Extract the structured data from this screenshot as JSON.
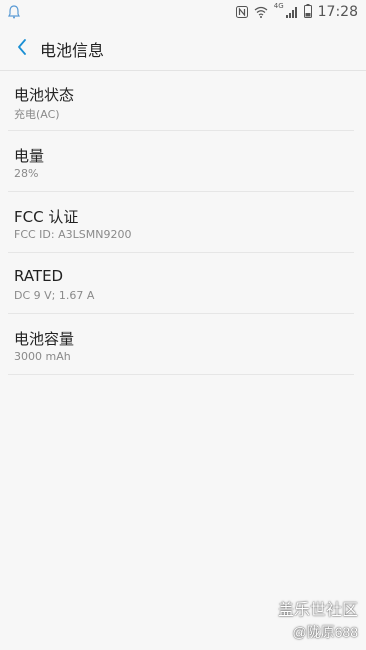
{
  "status_bar": {
    "time": "17:28",
    "network": "4G",
    "icons": [
      "nfc-icon",
      "wifi-icon",
      "signal-icon",
      "battery-icon"
    ]
  },
  "header": {
    "title": "电池信息",
    "back_icon": "back-icon"
  },
  "items": [
    {
      "title": "电池状态",
      "value": "充电(AC)"
    },
    {
      "title": "电量",
      "value": "28%"
    },
    {
      "title": "FCC 认证",
      "value": "FCC ID: A3LSMN9200"
    },
    {
      "title": "RATED",
      "value": "DC 9 V; 1.67 A"
    },
    {
      "title": "电池容量",
      "value": "3000 mAh"
    }
  ],
  "watermark": {
    "line1": "盖乐世社区",
    "line2": "@陇原688"
  },
  "colors": {
    "background": "#f7f7f7",
    "accent": "#1a8fd4",
    "secondary_text": "#8a8a8a"
  }
}
